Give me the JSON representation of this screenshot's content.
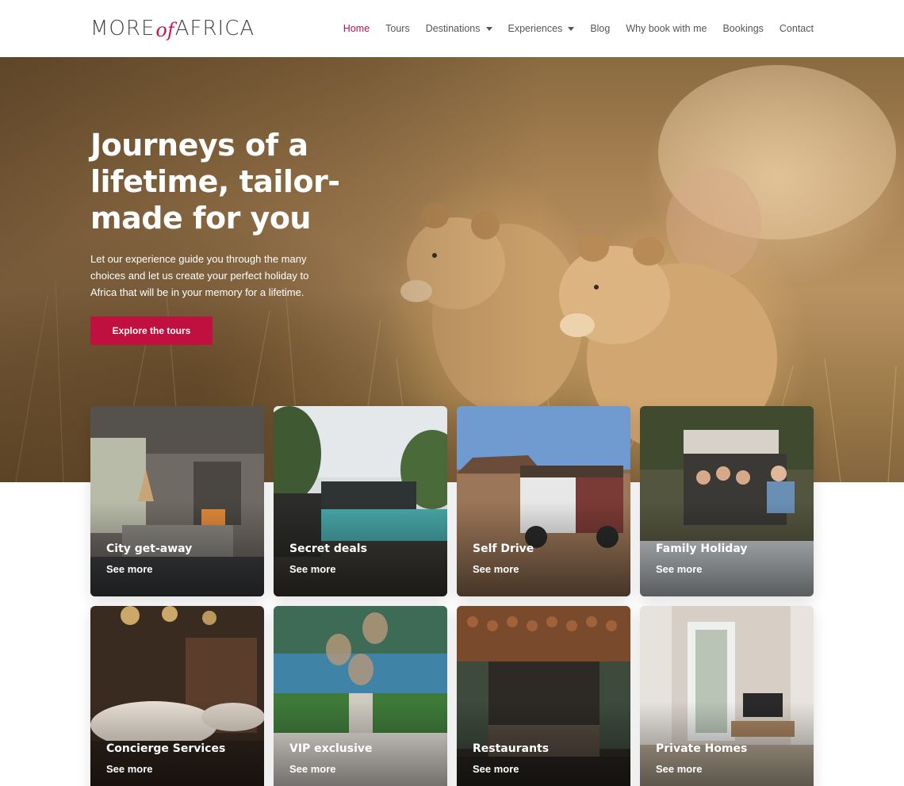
{
  "brand": {
    "logo_left": "MORE",
    "logo_mid": "of",
    "logo_right": "AFRICA"
  },
  "nav": {
    "home": "Home",
    "tours": "Tours",
    "destinations": "Destinations",
    "experiences": "Experiences",
    "blog": "Blog",
    "why": "Why book with me",
    "bookings": "Bookings",
    "contact": "Contact"
  },
  "hero": {
    "title": "Journeys of a lifetime, tailor-made for you",
    "text": "Let our experience guide you through the many choices and let us create your perfect holiday to Africa that will be in your memory for a lifetime.",
    "cta": "Explore the tours"
  },
  "cards": [
    {
      "title": "City get-away",
      "more": "See more"
    },
    {
      "title": "Secret deals",
      "more": "See more"
    },
    {
      "title": "Self Drive",
      "more": "See more"
    },
    {
      "title": "Family Holiday",
      "more": "See more"
    },
    {
      "title": "Concierge Services",
      "more": "See more"
    },
    {
      "title": "VIP exclusive",
      "more": "See more"
    },
    {
      "title": "Restaurants",
      "more": "See more"
    },
    {
      "title": "Private Homes",
      "more": "See more"
    }
  ],
  "colors": {
    "accent": "#c0103f",
    "nav_active": "#b4134a"
  }
}
